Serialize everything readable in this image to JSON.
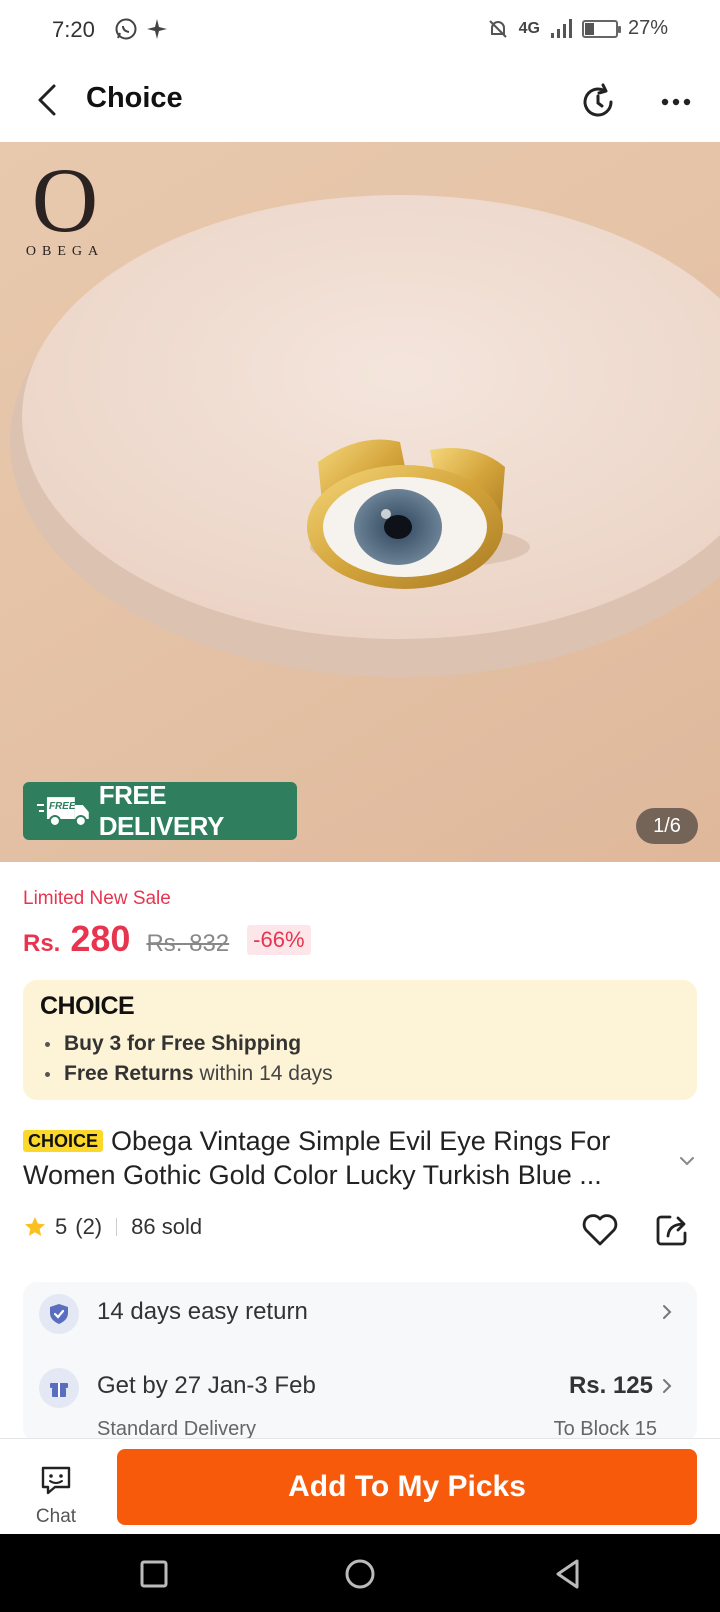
{
  "status_bar": {
    "time": "7:20",
    "network": "4G",
    "battery_percent": "27%",
    "battery_level": 0.27,
    "left_icons": [
      "whatsapp-icon",
      "sparkle-icon"
    ],
    "right_icons": [
      "bell-off-icon",
      "signal-icon",
      "battery-icon"
    ]
  },
  "header": {
    "title": "Choice",
    "icons": [
      "back-arrow-icon",
      "refresh-icon",
      "more-icon"
    ]
  },
  "hero": {
    "brand_letter": "O",
    "brand_name": "OBEGA",
    "free_delivery_tag": "FREE",
    "free_delivery_label": "FREE DELIVERY",
    "image_counter": "1/6",
    "colors": {
      "badge_bg": "#2f7f5e"
    }
  },
  "price": {
    "sale_label": "Limited New Sale",
    "currency": "Rs.",
    "current": "280",
    "original": "Rs. 832",
    "discount": "-66%"
  },
  "choice_box": {
    "logo": "CHOICE",
    "bullet1_bold": "Buy 3 for",
    "bullet1_rest": "Free Shipping",
    "bullet2_bold": "Free Returns",
    "bullet2_rest": "within 14 days"
  },
  "product": {
    "badge": "CHOICE",
    "title": "Obega Vintage Simple Evil Eye Rings For Women Gothic Gold Color Lucky Turkish Blue ...",
    "rating": "5",
    "reviews": "(2)",
    "sold": "86 sold"
  },
  "services": {
    "return_text": "14 days easy return",
    "delivery_text": "Get by 27 Jan-3 Feb",
    "delivery_sub": "Standard Delivery",
    "delivery_price": "Rs. 125",
    "delivery_price_sub": "To Block 15"
  },
  "bottom_bar": {
    "chat_label": "Chat",
    "add_label": "Add To My Picks"
  },
  "colors": {
    "accent_red": "#e8354f",
    "primary_orange": "#f85a0c",
    "choice_yellow": "#fcd82a",
    "choice_box_bg": "#fdf3d6"
  }
}
